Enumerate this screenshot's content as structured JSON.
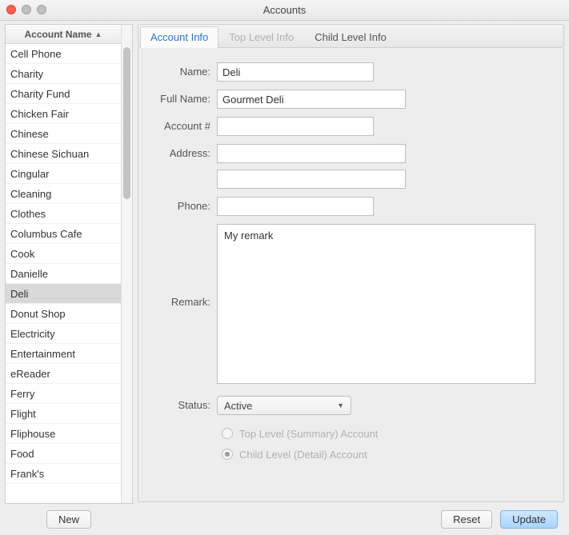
{
  "window": {
    "title": "Accounts"
  },
  "sidebar": {
    "header": "Account Name",
    "selected": "Deli",
    "items": [
      "Cell Phone",
      "Charity",
      "Charity Fund",
      "Chicken Fair",
      "Chinese",
      "Chinese Sichuan",
      "Cingular",
      "Cleaning",
      "Clothes",
      "Columbus Cafe",
      "Cook",
      "Danielle",
      "Deli",
      "Donut Shop",
      "Electricity",
      "Entertainment",
      "eReader",
      "Ferry",
      "Flight",
      "Fliphouse",
      "Food",
      "Frank's"
    ],
    "new_button": "New"
  },
  "tabs": {
    "items": [
      "Account Info",
      "Top Level Info",
      "Child Level Info"
    ],
    "active": 0,
    "disabled": 1
  },
  "form": {
    "labels": {
      "name": "Name:",
      "full_name": "Full Name:",
      "account_num": "Account #",
      "address": "Address:",
      "phone": "Phone:",
      "remark": "Remark:",
      "status": "Status:"
    },
    "values": {
      "name": "Deli",
      "full_name": "Gourmet Deli",
      "account_num": "",
      "address1": "",
      "address2": "",
      "phone": "",
      "remark": "My remark",
      "status": "Active"
    },
    "type_options": {
      "top": "Top Level (Summary) Account",
      "child": "Child Level (Detail) Account",
      "selected": "child"
    }
  },
  "footer": {
    "reset": "Reset",
    "update": "Update"
  }
}
